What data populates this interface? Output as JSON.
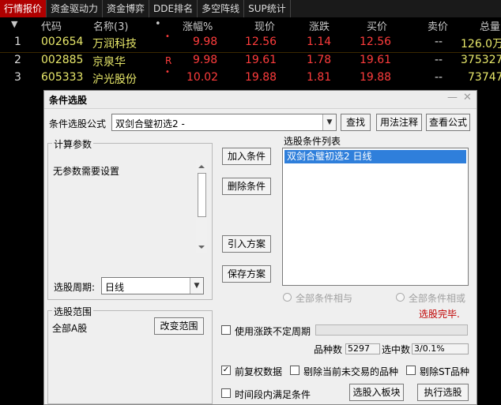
{
  "tabs": [
    "行情报价",
    "资金驱动力",
    "资金博弈",
    "DDE排名",
    "多空阵线",
    "SUP统计"
  ],
  "table": {
    "headers": {
      "arrow": "▼",
      "code": "代码",
      "name": "名称(3)",
      "dot": "•",
      "change_pct": "涨幅%",
      "price": "现价",
      "change": "涨跌",
      "bid": "买价",
      "ask": "卖价",
      "total": "总量"
    },
    "rows": [
      {
        "idx": "1",
        "code": "002654",
        "name": "万润科技",
        "mark": "•",
        "change_pct": "9.98",
        "price": "12.56",
        "change": "1.14",
        "bid": "12.56",
        "ask": "--",
        "total": "126.0万"
      },
      {
        "idx": "2",
        "code": "002885",
        "name": "京泉华",
        "mark": "R",
        "change_pct": "9.98",
        "price": "19.61",
        "change": "1.78",
        "bid": "19.61",
        "ask": "--",
        "total": "375327"
      },
      {
        "idx": "3",
        "code": "605333",
        "name": "沪光股份",
        "mark": "•",
        "change_pct": "10.02",
        "price": "19.88",
        "change": "1.81",
        "bid": "19.88",
        "ask": "--",
        "total": "73747"
      }
    ]
  },
  "dialog": {
    "title": "条件选股",
    "minimize": "—",
    "close": "✕",
    "formula_label": "条件选股公式",
    "formula_value": "双剑合璧初选2 -",
    "find_btn": "查找",
    "usage_btn": "用法注释",
    "view_btn": "查看公式",
    "params_group": "计算参数",
    "params_text": "无参数需要设置",
    "period_label": "选股周期:",
    "period_value": "日线",
    "scope_group": "选股范围",
    "scope_text": "全部A股",
    "change_scope_btn": "改变范围",
    "add_btn": "加入条件",
    "del_btn": "删除条件",
    "import_btn": "引入方案",
    "save_btn": "保存方案",
    "list_label": "选股条件列表",
    "list_items": [
      "双剑合璧初选2   日线"
    ],
    "radio_and": "全部条件相与",
    "radio_or": "全部条件相或",
    "status": "选股完毕.",
    "uncertain_label": "使用涨跌不定周期",
    "count_label": "品种数",
    "count_value": "5297",
    "selected_label": "选中数",
    "selected_value": "3/0.1%",
    "pre_adj_label": "前复权数据",
    "pre_adj_check": "✓",
    "exclude_untraded_label": "剔除当前未交易的品种",
    "exclude_st_label": "剔除ST品种",
    "period_satisfy_label": "时间段内满足条件",
    "to_block_btn": "选股入板块",
    "execute_btn": "执行选股"
  },
  "colors": {
    "up": "#ff3c3c",
    "code": "#e8e86a",
    "tab_active": "#b00000",
    "selection": "#2f7fdb",
    "status": "#c00000"
  }
}
